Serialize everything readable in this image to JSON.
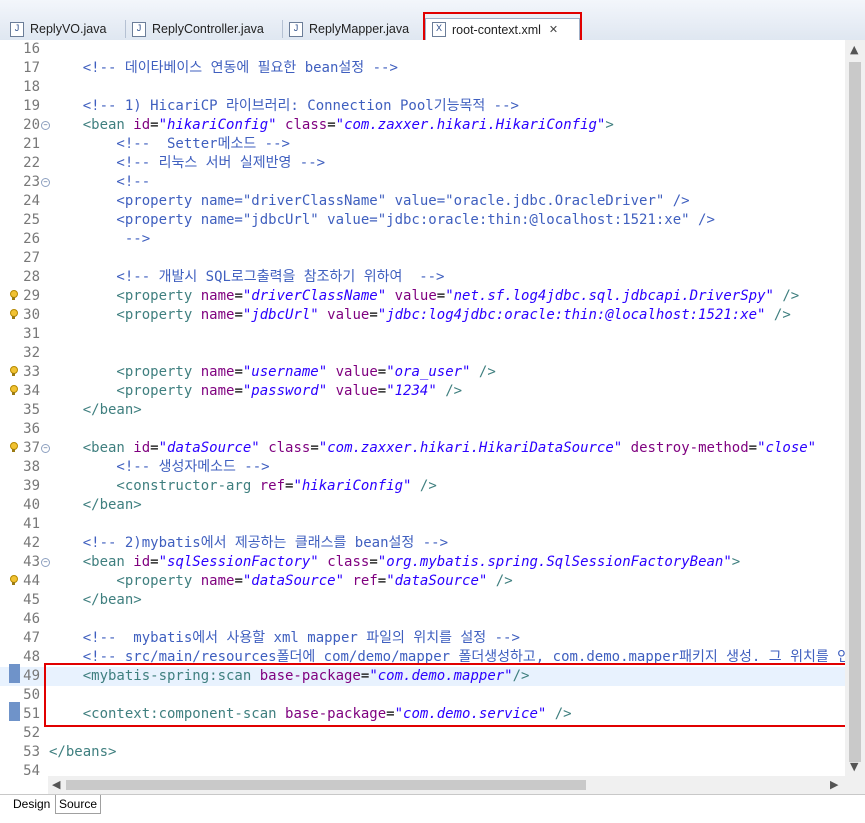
{
  "tabs": [
    {
      "label": "ReplyVO.java",
      "icon": "J"
    },
    {
      "label": "ReplyController.java",
      "icon": "J"
    },
    {
      "label": "ReplyMapper.java",
      "icon": "J"
    },
    {
      "label": "root-context.xml",
      "icon": "X",
      "active": true
    }
  ],
  "close_glyph": "✕",
  "colors": {
    "tag": "#3f7f7f",
    "attr": "#7f007f",
    "value": "#2a00ff",
    "comment": "#3f5fbf",
    "highlight": "#e10000",
    "current_line": "#e8f2fe"
  },
  "lines": [
    {
      "n": "16",
      "segs": []
    },
    {
      "n": "17",
      "segs": [
        [
          "c",
          "    <!-- 데이타베이스 연동에 필요한 bean설정 -->"
        ]
      ]
    },
    {
      "n": "18",
      "segs": []
    },
    {
      "n": "19",
      "segs": [
        [
          "c",
          "    <!-- 1) HicariCP 라이브러리: Connection Pool기능목적 -->"
        ]
      ]
    },
    {
      "n": "20",
      "fold": true,
      "segs": [
        [
          "t",
          "    <bean "
        ],
        [
          "a",
          "id"
        ],
        [
          "p",
          "="
        ],
        [
          "vi",
          "\"hikariConfig\""
        ],
        [
          "p",
          " "
        ],
        [
          "a",
          "class"
        ],
        [
          "p",
          "="
        ],
        [
          "vi",
          "\"com.zaxxer.hikari.HikariConfig\""
        ],
        [
          "t",
          ">"
        ]
      ]
    },
    {
      "n": "21",
      "segs": [
        [
          "c",
          "        <!--  Setter메소드 -->"
        ]
      ]
    },
    {
      "n": "22",
      "segs": [
        [
          "c",
          "        <!-- 리눅스 서버 실제반영 -->"
        ]
      ]
    },
    {
      "n": "23",
      "fold": true,
      "segs": [
        [
          "c",
          "        <!--"
        ]
      ]
    },
    {
      "n": "24",
      "segs": [
        [
          "c",
          "        <property name=\"driverClassName\" value=\"oracle.jdbc.OracleDriver\" />"
        ]
      ]
    },
    {
      "n": "25",
      "segs": [
        [
          "c",
          "        <property name=\"jdbcUrl\" value=\"jdbc:oracle:thin:@localhost:1521:xe\" />"
        ]
      ]
    },
    {
      "n": "26",
      "segs": [
        [
          "c",
          "         -->"
        ]
      ]
    },
    {
      "n": "27",
      "segs": []
    },
    {
      "n": "28",
      "segs": [
        [
          "c",
          "        <!-- 개발시 SQL로그출력을 참조하기 위하여  -->"
        ]
      ]
    },
    {
      "n": "29",
      "warn": true,
      "segs": [
        [
          "t",
          "        <property "
        ],
        [
          "a",
          "name"
        ],
        [
          "p",
          "="
        ],
        [
          "vi",
          "\"driverClassName\""
        ],
        [
          "p",
          " "
        ],
        [
          "a",
          "value"
        ],
        [
          "p",
          "="
        ],
        [
          "vi",
          "\"net.sf.log4jdbc.sql.jdbcapi.DriverSpy\""
        ],
        [
          "t",
          " />"
        ]
      ]
    },
    {
      "n": "30",
      "warn": true,
      "segs": [
        [
          "t",
          "        <property "
        ],
        [
          "a",
          "name"
        ],
        [
          "p",
          "="
        ],
        [
          "vi",
          "\"jdbcUrl\""
        ],
        [
          "p",
          " "
        ],
        [
          "a",
          "value"
        ],
        [
          "p",
          "="
        ],
        [
          "vi",
          "\"jdbc:log4jdbc:oracle:thin:@localhost:1521:xe\""
        ],
        [
          "t",
          " />"
        ]
      ]
    },
    {
      "n": "31",
      "segs": []
    },
    {
      "n": "32",
      "segs": []
    },
    {
      "n": "33",
      "warn": true,
      "segs": [
        [
          "t",
          "        <property "
        ],
        [
          "a",
          "name"
        ],
        [
          "p",
          "="
        ],
        [
          "vi",
          "\"username\""
        ],
        [
          "p",
          " "
        ],
        [
          "a",
          "value"
        ],
        [
          "p",
          "="
        ],
        [
          "vi",
          "\"ora_user\""
        ],
        [
          "t",
          " />"
        ]
      ]
    },
    {
      "n": "34",
      "warn": true,
      "segs": [
        [
          "t",
          "        <property "
        ],
        [
          "a",
          "name"
        ],
        [
          "p",
          "="
        ],
        [
          "vi",
          "\"password\""
        ],
        [
          "p",
          " "
        ],
        [
          "a",
          "value"
        ],
        [
          "p",
          "="
        ],
        [
          "vi",
          "\"1234\""
        ],
        [
          "t",
          " />"
        ]
      ]
    },
    {
      "n": "35",
      "segs": [
        [
          "t",
          "    </bean>"
        ]
      ]
    },
    {
      "n": "36",
      "segs": []
    },
    {
      "n": "37",
      "warn": true,
      "fold": true,
      "segs": [
        [
          "t",
          "    <bean "
        ],
        [
          "a",
          "id"
        ],
        [
          "p",
          "="
        ],
        [
          "vi",
          "\"dataSource\""
        ],
        [
          "p",
          " "
        ],
        [
          "a",
          "class"
        ],
        [
          "p",
          "="
        ],
        [
          "vi",
          "\"com.zaxxer.hikari.HikariDataSource\""
        ],
        [
          "p",
          " "
        ],
        [
          "a",
          "destroy-method"
        ],
        [
          "p",
          "="
        ],
        [
          "vi",
          "\"close\""
        ]
      ]
    },
    {
      "n": "38",
      "segs": [
        [
          "c",
          "        <!-- 생성자메소드 -->"
        ]
      ]
    },
    {
      "n": "39",
      "segs": [
        [
          "t",
          "        <constructor-arg "
        ],
        [
          "a",
          "ref"
        ],
        [
          "p",
          "="
        ],
        [
          "vi",
          "\"hikariConfig\""
        ],
        [
          "t",
          " />"
        ]
      ]
    },
    {
      "n": "40",
      "segs": [
        [
          "t",
          "    </bean>"
        ]
      ]
    },
    {
      "n": "41",
      "segs": []
    },
    {
      "n": "42",
      "segs": [
        [
          "c",
          "    <!-- 2)mybatis에서 제공하는 클래스를 bean설정 -->"
        ]
      ]
    },
    {
      "n": "43",
      "fold": true,
      "segs": [
        [
          "t",
          "    <bean "
        ],
        [
          "a",
          "id"
        ],
        [
          "p",
          "="
        ],
        [
          "vi",
          "\"sqlSessionFactory\""
        ],
        [
          "p",
          " "
        ],
        [
          "a",
          "class"
        ],
        [
          "p",
          "="
        ],
        [
          "vi",
          "\"org.mybatis.spring.SqlSessionFactoryBean\""
        ],
        [
          "t",
          ">"
        ]
      ]
    },
    {
      "n": "44",
      "warn": true,
      "segs": [
        [
          "t",
          "        <property "
        ],
        [
          "a",
          "name"
        ],
        [
          "p",
          "="
        ],
        [
          "vi",
          "\"dataSource\""
        ],
        [
          "p",
          " "
        ],
        [
          "a",
          "ref"
        ],
        [
          "p",
          "="
        ],
        [
          "vi",
          "\"dataSource\""
        ],
        [
          "t",
          " />"
        ]
      ]
    },
    {
      "n": "45",
      "segs": [
        [
          "t",
          "    </bean>"
        ]
      ]
    },
    {
      "n": "46",
      "segs": []
    },
    {
      "n": "47",
      "segs": [
        [
          "c",
          "    <!--  mybatis에서 사용할 xml mapper 파일의 위치를 설정 -->"
        ]
      ]
    },
    {
      "n": "48",
      "segs": [
        [
          "c",
          "    <!-- src/main/resources폴더에 com/demo/mapper 폴더생성하고, com.demo.mapper패키지 생성. 그 위치를 인식"
        ]
      ]
    },
    {
      "n": "49",
      "current": true,
      "segs": [
        [
          "t",
          "    <mybatis-spring:scan "
        ],
        [
          "a",
          "base-package"
        ],
        [
          "p",
          "="
        ],
        [
          "vi",
          "\"com.demo.mapper\""
        ],
        [
          "t",
          "/>"
        ]
      ]
    },
    {
      "n": "50",
      "segs": []
    },
    {
      "n": "51",
      "segs": [
        [
          "t",
          "    <context:component-scan "
        ],
        [
          "a",
          "base-package"
        ],
        [
          "p",
          "="
        ],
        [
          "vi",
          "\"com.demo.service\""
        ],
        [
          "t",
          " />"
        ]
      ]
    },
    {
      "n": "52",
      "segs": []
    },
    {
      "n": "53",
      "segs": [
        [
          "t",
          "</beans>"
        ]
      ]
    },
    {
      "n": "54",
      "segs": []
    }
  ],
  "bottom_tabs": [
    {
      "label": "Design"
    },
    {
      "label": "Source",
      "active": true
    }
  ]
}
